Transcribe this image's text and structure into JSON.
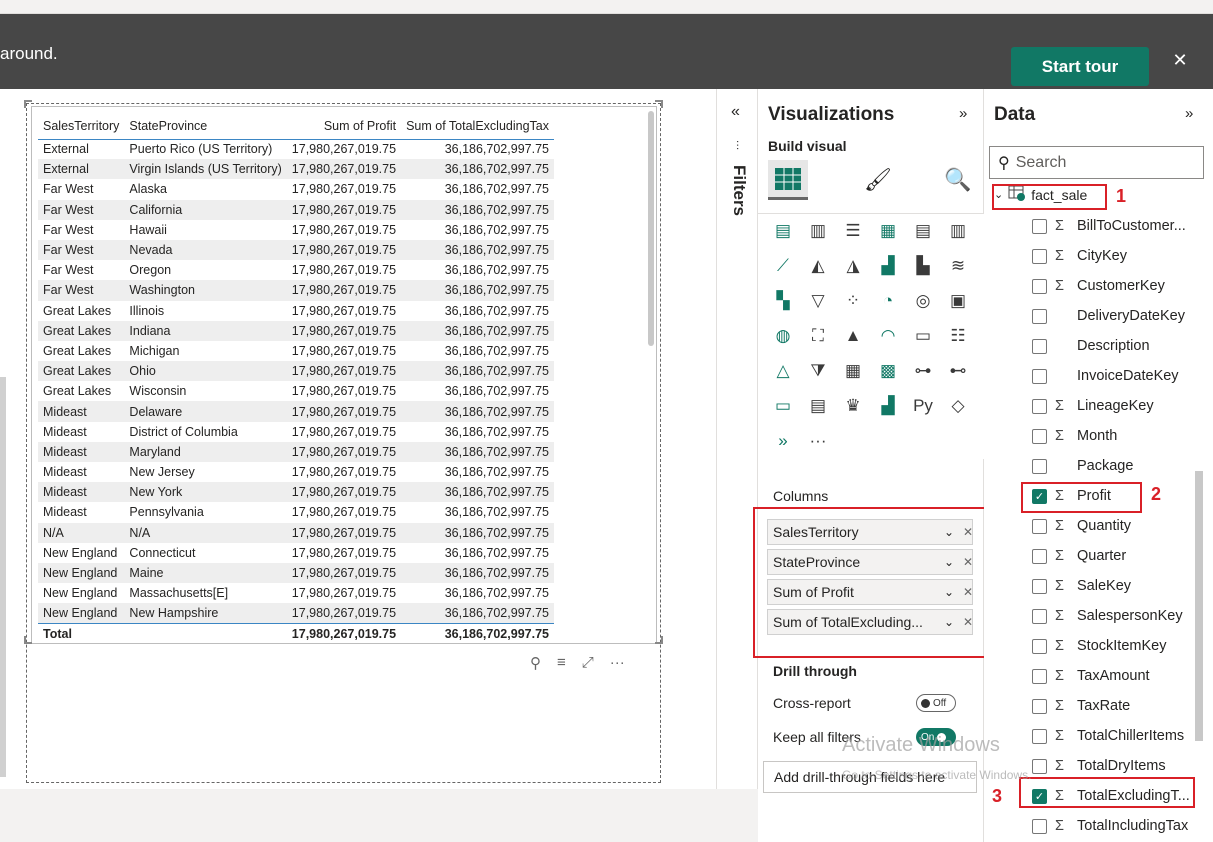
{
  "banner": {
    "message": "around.",
    "start_tour": "Start tour",
    "close": "✕"
  },
  "table": {
    "headers": [
      "SalesTerritory",
      "StateProvince",
      "Sum of Profit",
      "Sum of TotalExcludingTax"
    ],
    "rows": [
      [
        "External",
        "Puerto Rico (US Territory)",
        "17,980,267,019.75",
        "36,186,702,997.75"
      ],
      [
        "External",
        "Virgin Islands (US Territory)",
        "17,980,267,019.75",
        "36,186,702,997.75"
      ],
      [
        "Far West",
        "Alaska",
        "17,980,267,019.75",
        "36,186,702,997.75"
      ],
      [
        "Far West",
        "California",
        "17,980,267,019.75",
        "36,186,702,997.75"
      ],
      [
        "Far West",
        "Hawaii",
        "17,980,267,019.75",
        "36,186,702,997.75"
      ],
      [
        "Far West",
        "Nevada",
        "17,980,267,019.75",
        "36,186,702,997.75"
      ],
      [
        "Far West",
        "Oregon",
        "17,980,267,019.75",
        "36,186,702,997.75"
      ],
      [
        "Far West",
        "Washington",
        "17,980,267,019.75",
        "36,186,702,997.75"
      ],
      [
        "Great Lakes",
        "Illinois",
        "17,980,267,019.75",
        "36,186,702,997.75"
      ],
      [
        "Great Lakes",
        "Indiana",
        "17,980,267,019.75",
        "36,186,702,997.75"
      ],
      [
        "Great Lakes",
        "Michigan",
        "17,980,267,019.75",
        "36,186,702,997.75"
      ],
      [
        "Great Lakes",
        "Ohio",
        "17,980,267,019.75",
        "36,186,702,997.75"
      ],
      [
        "Great Lakes",
        "Wisconsin",
        "17,980,267,019.75",
        "36,186,702,997.75"
      ],
      [
        "Mideast",
        "Delaware",
        "17,980,267,019.75",
        "36,186,702,997.75"
      ],
      [
        "Mideast",
        "District of Columbia",
        "17,980,267,019.75",
        "36,186,702,997.75"
      ],
      [
        "Mideast",
        "Maryland",
        "17,980,267,019.75",
        "36,186,702,997.75"
      ],
      [
        "Mideast",
        "New Jersey",
        "17,980,267,019.75",
        "36,186,702,997.75"
      ],
      [
        "Mideast",
        "New York",
        "17,980,267,019.75",
        "36,186,702,997.75"
      ],
      [
        "Mideast",
        "Pennsylvania",
        "17,980,267,019.75",
        "36,186,702,997.75"
      ],
      [
        "N/A",
        "N/A",
        "17,980,267,019.75",
        "36,186,702,997.75"
      ],
      [
        "New England",
        "Connecticut",
        "17,980,267,019.75",
        "36,186,702,997.75"
      ],
      [
        "New England",
        "Maine",
        "17,980,267,019.75",
        "36,186,702,997.75"
      ],
      [
        "New England",
        "Massachusetts[E]",
        "17,980,267,019.75",
        "36,186,702,997.75"
      ],
      [
        "New England",
        "New Hampshire",
        "17,980,267,019.75",
        "36,186,702,997.75"
      ]
    ],
    "total": [
      "Total",
      "",
      "17,980,267,019.75",
      "36,186,702,997.75"
    ]
  },
  "visual_icons": [
    "pin-icon",
    "filter-icon",
    "focus-mode-icon",
    "more-options-icon"
  ],
  "filters": {
    "label": "Filters",
    "collapse": "«"
  },
  "visualizations": {
    "title": "Visualizations",
    "expand": "»",
    "build_visual": "Build visual",
    "more": "···",
    "columns_label": "Columns",
    "columns": [
      {
        "label": "SalesTerritory"
      },
      {
        "label": "StateProvince"
      },
      {
        "label": "Sum of Profit"
      },
      {
        "label": "Sum of TotalExcluding..."
      }
    ],
    "drill_through": "Drill through",
    "cross_report": "Cross-report",
    "cross_report_state": "Off",
    "keep_all_filters": "Keep all filters",
    "keep_all_state": "On",
    "drill_drop": "Add drill-through fields here"
  },
  "data_pane": {
    "title": "Data",
    "expand": "»",
    "search_placeholder": "Search",
    "table_name": "fact_sale",
    "fields": [
      {
        "name": "BillToCustomer...",
        "sigma": true,
        "checked": false
      },
      {
        "name": "CityKey",
        "sigma": true,
        "checked": false
      },
      {
        "name": "CustomerKey",
        "sigma": true,
        "checked": false
      },
      {
        "name": "DeliveryDateKey",
        "sigma": false,
        "checked": false
      },
      {
        "name": "Description",
        "sigma": false,
        "checked": false
      },
      {
        "name": "InvoiceDateKey",
        "sigma": false,
        "checked": false
      },
      {
        "name": "LineageKey",
        "sigma": true,
        "checked": false
      },
      {
        "name": "Month",
        "sigma": true,
        "checked": false
      },
      {
        "name": "Package",
        "sigma": false,
        "checked": false
      },
      {
        "name": "Profit",
        "sigma": true,
        "checked": true
      },
      {
        "name": "Quantity",
        "sigma": true,
        "checked": false
      },
      {
        "name": "Quarter",
        "sigma": true,
        "checked": false
      },
      {
        "name": "SaleKey",
        "sigma": true,
        "checked": false
      },
      {
        "name": "SalespersonKey",
        "sigma": true,
        "checked": false
      },
      {
        "name": "StockItemKey",
        "sigma": true,
        "checked": false
      },
      {
        "name": "TaxAmount",
        "sigma": true,
        "checked": false
      },
      {
        "name": "TaxRate",
        "sigma": true,
        "checked": false
      },
      {
        "name": "TotalChillerItems",
        "sigma": true,
        "checked": false
      },
      {
        "name": "TotalDryItems",
        "sigma": true,
        "checked": false
      },
      {
        "name": "TotalExcludingT...",
        "sigma": true,
        "checked": true
      },
      {
        "name": "TotalIncludingTax",
        "sigma": true,
        "checked": false
      }
    ]
  },
  "callouts": [
    "1",
    "2",
    "3"
  ],
  "watermark": {
    "title": "Activate Windows",
    "sub": "Go to Settings to activate Windows."
  },
  "colors": {
    "accent": "#117865",
    "callout": "#d92027",
    "banner": "#474747"
  }
}
